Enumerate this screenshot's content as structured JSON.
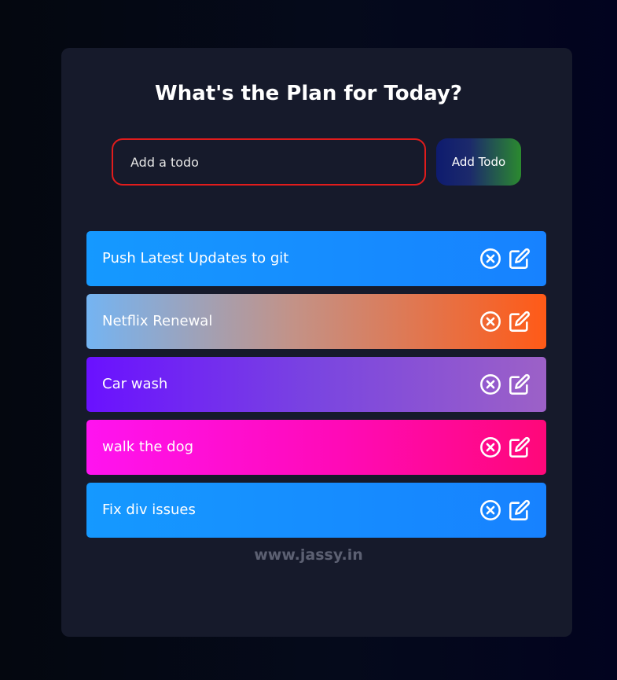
{
  "header": {
    "title": "What's the Plan for Today?"
  },
  "form": {
    "placeholder": "Add a todo",
    "value": "",
    "add_label": "Add Todo"
  },
  "todos": [
    {
      "text": "Push Latest Updates to git"
    },
    {
      "text": "Netflix Renewal"
    },
    {
      "text": "Car wash"
    },
    {
      "text": "walk the dog"
    },
    {
      "text": "Fix div issues"
    }
  ],
  "icons": {
    "delete": "close-circle-icon",
    "edit": "edit-icon"
  },
  "footer": {
    "watermark": "www.jassy.in"
  },
  "colors": {
    "page_background": "#050a1b",
    "card_background": "#161a2b",
    "input_border": "#e11c1c",
    "todo_gradients": [
      [
        "#1599ff",
        "#1782ff"
      ],
      [
        "#74b4f2",
        "#ff5a17"
      ],
      [
        "#6a11ff",
        "#9c61c7"
      ],
      [
        "#ff13f0",
        "#ff0879"
      ],
      [
        "#1599ff",
        "#1782ff"
      ]
    ]
  }
}
